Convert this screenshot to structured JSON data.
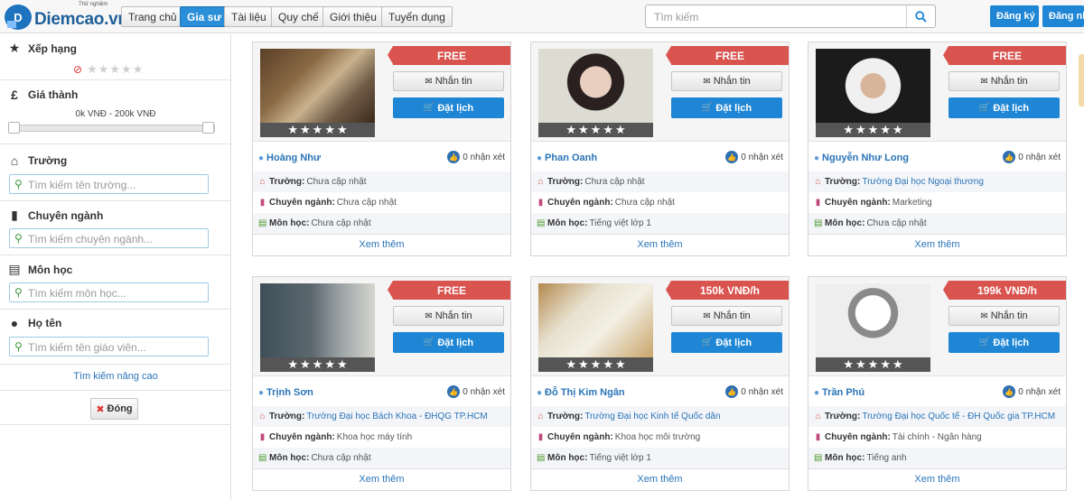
{
  "header": {
    "logo_text": "Diemcao.vn",
    "logo_tag": "Thử nghiệm",
    "nav": [
      "Trang chủ",
      "Gia sư",
      "Tài liệu",
      "Quy chế",
      "Giới thiệu",
      "Tuyển dụng"
    ],
    "active_nav": "Gia sư",
    "search_placeholder": "Tìm kiếm",
    "register_label": "Đăng ký",
    "login_label": "Đăng nh"
  },
  "sidebar": {
    "rating": {
      "label": "Xếp hạng",
      "stars": 5,
      "selected": 0
    },
    "price": {
      "label": "Giá thành",
      "range_text": "0k VNĐ - 200k VNĐ",
      "min": 0,
      "max": 200
    },
    "school": {
      "label": "Trường",
      "placeholder": "Tìm kiếm tên trường..."
    },
    "major": {
      "label": "Chuyên ngành",
      "placeholder": "Tìm kiếm chuyên ngành..."
    },
    "subject": {
      "label": "Môn học",
      "placeholder": "Tìm kiếm môn học..."
    },
    "name": {
      "label": "Họ tên",
      "placeholder": "Tìm kiếm tên giáo viên..."
    },
    "advanced_link": "Tìm kiếm nâng cao",
    "close_label": "Đóng"
  },
  "labels": {
    "message": "Nhắn tin",
    "book": "Đặt lịch",
    "school": "Trường:",
    "major": "Chuyên ngành:",
    "subject": "Môn học:",
    "more": "Xem thêm",
    "reviews_suffix": "nhận xét"
  },
  "tutors": [
    {
      "name": "Hoàng Như",
      "price": "FREE",
      "reviews": "0 nhận xét",
      "school": "Chưa cập nhật",
      "school_link": false,
      "major": "Chưa cập nhật",
      "subject": "Chưa cập nhật",
      "photo": "warm"
    },
    {
      "name": "Phan Oanh",
      "price": "FREE",
      "reviews": "0 nhận xét",
      "school": "Chưa cập nhật",
      "school_link": false,
      "major": "Chưa cập nhật",
      "subject": "Tiếng việt lớp 1",
      "photo": "pale"
    },
    {
      "name": "Nguyễn Như Long",
      "price": "FREE",
      "reviews": "0 nhận xét",
      "school": "Trường Đại học Ngoại thương",
      "school_link": true,
      "major": "Marketing",
      "subject": "Chưa cập nhật",
      "photo": "dark"
    },
    {
      "name": "Trịnh Sơn",
      "price": "FREE",
      "reviews": "0 nhận xét",
      "school": "Trường Đại học Bách Khoa - ĐHQG TP.HCM",
      "school_link": true,
      "major": "Khoa học máy tính",
      "subject": "Chưa cập nhật",
      "photo": "room"
    },
    {
      "name": "Đỗ Thị Kim Ngân",
      "price": "150k VNĐ/h",
      "reviews": "0 nhận xét",
      "school": "Trường Đại học Kinh tế Quốc dân",
      "school_link": true,
      "major": "Khoa học môi trường",
      "subject": "Tiếng việt lớp 1",
      "photo": "note"
    },
    {
      "name": "Trần Phú",
      "price": "199k VNĐ/h",
      "reviews": "0 nhận xét",
      "school": "Trường Đại học Quốc tế - ĐH Quốc gia TP.HCM",
      "school_link": true,
      "major": "Tài chính - Ngân hàng",
      "subject": "Tiếng anh",
      "photo": "avatar"
    }
  ],
  "colors": {
    "primary": "#1e86d4",
    "price_ribbon": "#d9534f",
    "link": "#2a74b8"
  }
}
